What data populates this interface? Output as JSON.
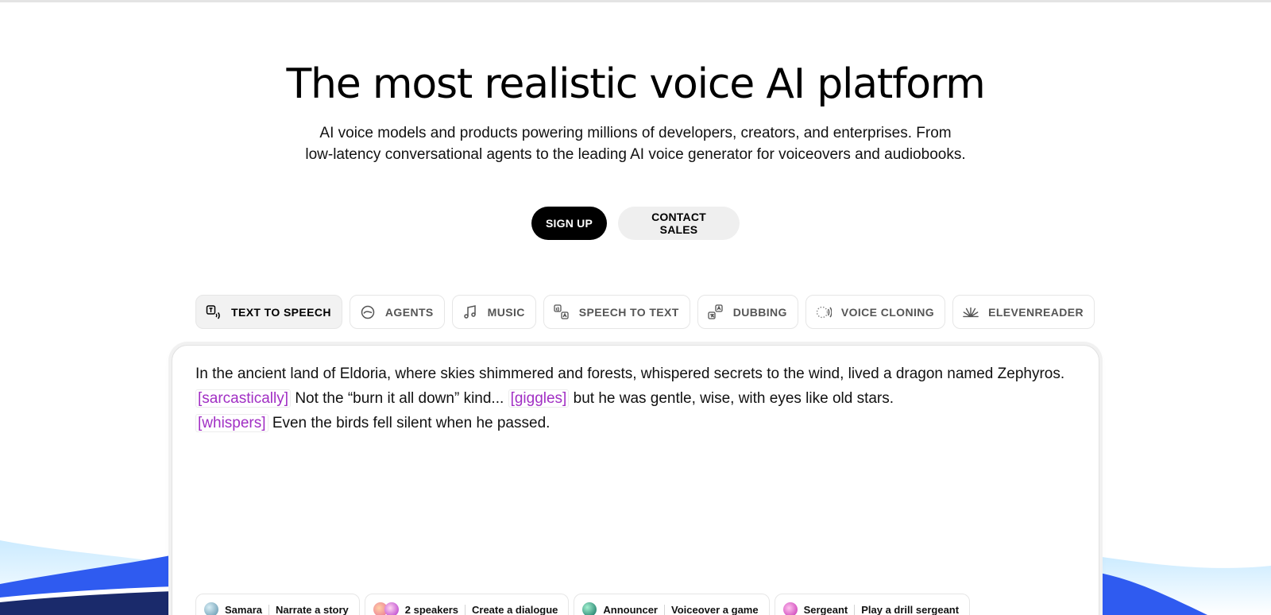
{
  "hero": {
    "title": "The most realistic voice AI platform",
    "subtitle_line1": "AI voice models and products powering millions of developers, creators, and enterprises. From",
    "subtitle_line2": "low-latency conversational agents to the leading AI voice generator for voiceovers and audiobooks."
  },
  "cta": {
    "signup": "SIGN UP",
    "contact": "CONTACT SALES"
  },
  "tabs": [
    {
      "label": "TEXT TO SPEECH",
      "icon": "text-to-speech-icon",
      "active": true
    },
    {
      "label": "AGENTS",
      "icon": "agents-icon",
      "active": false
    },
    {
      "label": "MUSIC",
      "icon": "music-note-icon",
      "active": false
    },
    {
      "label": "SPEECH TO TEXT",
      "icon": "speech-to-text-icon",
      "active": false
    },
    {
      "label": "DUBBING",
      "icon": "dubbing-icon",
      "active": false
    },
    {
      "label": "VOICE CLONING",
      "icon": "voice-cloning-icon",
      "active": false
    },
    {
      "label": "ELEVENREADER",
      "icon": "elevenreader-icon",
      "active": false
    }
  ],
  "editor": {
    "seg1": "In the ancient land of Eldoria, where skies shimmered and forests, whispered secrets to the wind, lived a dragon named Zephyros.",
    "tag1": "[sarcastically]",
    "seg2": "Not the “burn it all down” kind...",
    "tag2": "[giggles]",
    "seg3": "but he was gentle, wise, with eyes like old stars.",
    "tag3": "[whispers]",
    "seg4": "Even the birds fell silent when he passed."
  },
  "presets": [
    {
      "voice": "Samara",
      "action": "Narrate a story"
    },
    {
      "voice": "2 speakers",
      "action": "Create a dialogue"
    },
    {
      "voice": "Announcer",
      "action": "Voiceover a game"
    },
    {
      "voice": "Sergeant",
      "action": "Play a drill sergeant"
    }
  ],
  "colors": {
    "tag": "#a12fc4",
    "primary_button": "#000000",
    "secondary_button": "#efefef",
    "wave_blue": "#2f5bf0"
  }
}
